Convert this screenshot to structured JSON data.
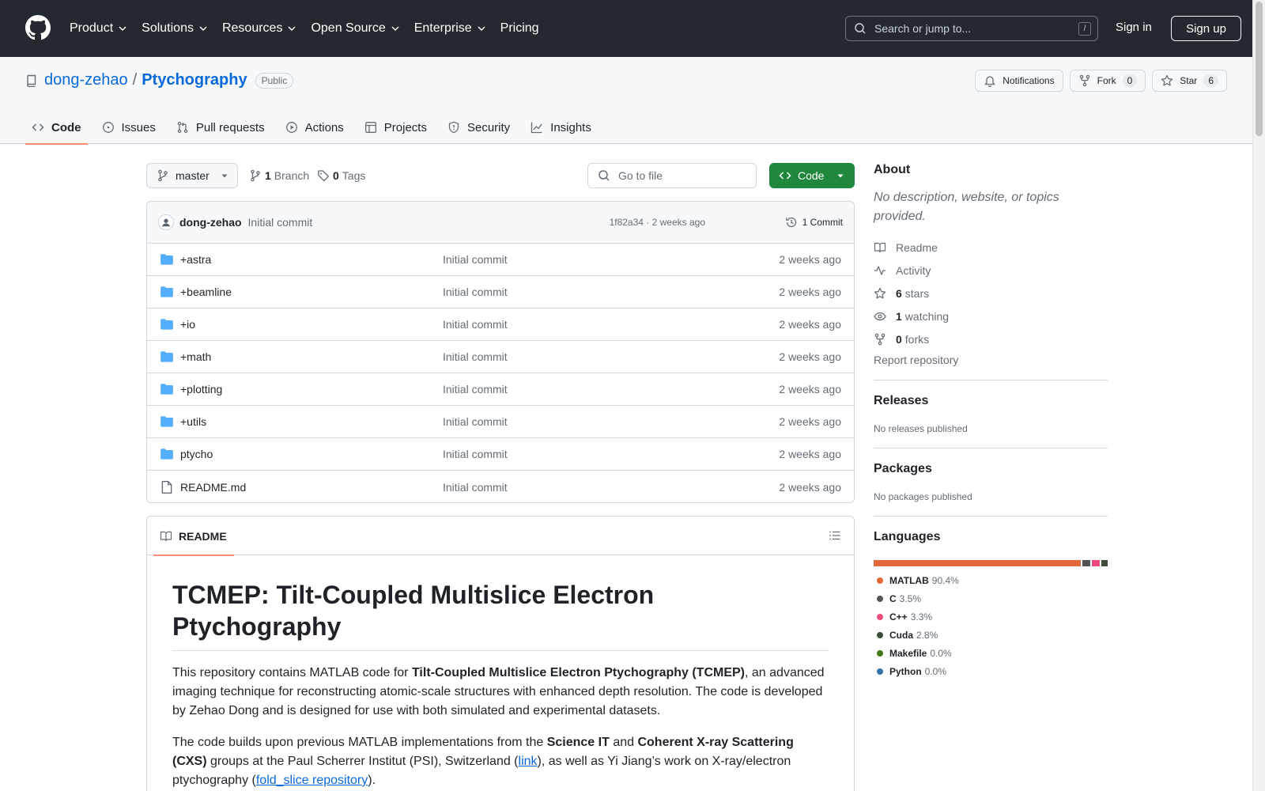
{
  "header": {
    "nav": [
      {
        "label": "Product",
        "dropdown": true
      },
      {
        "label": "Solutions",
        "dropdown": true
      },
      {
        "label": "Resources",
        "dropdown": true
      },
      {
        "label": "Open Source",
        "dropdown": true
      },
      {
        "label": "Enterprise",
        "dropdown": true
      },
      {
        "label": "Pricing",
        "dropdown": false
      }
    ],
    "search_placeholder": "Search or jump to...",
    "search_shortcut": "/",
    "signin_label": "Sign in",
    "signup_label": "Sign up"
  },
  "repo": {
    "owner": "dong-zehao",
    "separator": "/",
    "name": "Ptychography",
    "visibility": "Public",
    "notifications_label": "Notifications",
    "fork_label": "Fork",
    "fork_count": "0",
    "star_label": "Star",
    "star_count": "6"
  },
  "tabs": [
    {
      "label": "Code",
      "icon": "code-icon",
      "active": true
    },
    {
      "label": "Issues",
      "icon": "issue-icon",
      "active": false
    },
    {
      "label": "Pull requests",
      "icon": "pull-request-icon",
      "active": false
    },
    {
      "label": "Actions",
      "icon": "play-icon",
      "active": false
    },
    {
      "label": "Projects",
      "icon": "table-icon",
      "active": false
    },
    {
      "label": "Security",
      "icon": "shield-icon",
      "active": false
    },
    {
      "label": "Insights",
      "icon": "graph-icon",
      "active": false
    }
  ],
  "toolbar": {
    "branch": "master",
    "branch_count": "1",
    "branch_label": "Branch",
    "tag_count": "0",
    "tag_label": "Tags",
    "goto_placeholder": "Go to file",
    "code_label": "Code"
  },
  "commit": {
    "author": "dong-zehao",
    "message": "Initial commit",
    "hash_time": "1f82a34 · 2 weeks ago",
    "count_label": "1 Commit"
  },
  "files": [
    {
      "name": "+astra",
      "type": "folder",
      "message": "Initial commit",
      "date": "2 weeks ago"
    },
    {
      "name": "+beamline",
      "type": "folder",
      "message": "Initial commit",
      "date": "2 weeks ago"
    },
    {
      "name": "+io",
      "type": "folder",
      "message": "Initial commit",
      "date": "2 weeks ago"
    },
    {
      "name": "+math",
      "type": "folder",
      "message": "Initial commit",
      "date": "2 weeks ago"
    },
    {
      "name": "+plotting",
      "type": "folder",
      "message": "Initial commit",
      "date": "2 weeks ago"
    },
    {
      "name": "+utils",
      "type": "folder",
      "message": "Initial commit",
      "date": "2 weeks ago"
    },
    {
      "name": "ptycho",
      "type": "folder",
      "message": "Initial commit",
      "date": "2 weeks ago"
    },
    {
      "name": "README.md",
      "type": "file",
      "message": "Initial commit",
      "date": "2 weeks ago"
    }
  ],
  "readme": {
    "tab_label": "README",
    "title": "TCMEP: Tilt-Coupled Multislice Electron Ptychography",
    "p1_a": "This repository contains MATLAB code for ",
    "p1_b": "Tilt-Coupled Multislice Electron Ptychography (TCMEP)",
    "p1_c": ", an advanced imaging technique for reconstructing atomic-scale structures with enhanced depth resolution. The code is developed by Zehao Dong and is designed for use with both simulated and experimental datasets.",
    "p2_a": "The code builds upon previous MATLAB implementations from the ",
    "p2_b": "Science IT",
    "p2_c": " and ",
    "p2_d": "Coherent X-ray Scattering (CXS)",
    "p2_e": " groups at the Paul Scherrer Institut (PSI), Switzerland (",
    "p2_link1": "link",
    "p2_f": "), as well as Yi Jiang’s work on X-ray/electron ptychography (",
    "p2_link2": "fold_slice repository",
    "p2_g": ")."
  },
  "about": {
    "heading": "About",
    "description": "No description, website, or topics provided.",
    "readme_label": "Readme",
    "activity_label": "Activity",
    "stars_count": "6",
    "stars_label": "stars",
    "watching_count": "1",
    "watching_label": "watching",
    "forks_count": "0",
    "forks_label": "forks",
    "report_label": "Report repository"
  },
  "releases": {
    "heading": "Releases",
    "empty": "No releases published"
  },
  "packages": {
    "heading": "Packages",
    "empty": "No packages published"
  },
  "languages": {
    "heading": "Languages",
    "items": [
      {
        "name": "MATLAB",
        "percent": "90.4%",
        "value": 90.4,
        "color": "#e16737"
      },
      {
        "name": "C",
        "percent": "3.5%",
        "value": 3.5,
        "color": "#555555"
      },
      {
        "name": "C++",
        "percent": "3.3%",
        "value": 3.3,
        "color": "#f34b7d"
      },
      {
        "name": "Cuda",
        "percent": "2.8%",
        "value": 2.8,
        "color": "#3a4e3a"
      },
      {
        "name": "Makefile",
        "percent": "0.0%",
        "value": 0.0,
        "color": "#427819"
      },
      {
        "name": "Python",
        "percent": "0.0%",
        "value": 0.0,
        "color": "#3572a5"
      }
    ]
  },
  "colors": {
    "header_bg": "#24292f",
    "link": "#0969da",
    "primary_button": "#1f883d",
    "active_tab_underline": "#fd8c73",
    "folder": "#54aeff"
  }
}
